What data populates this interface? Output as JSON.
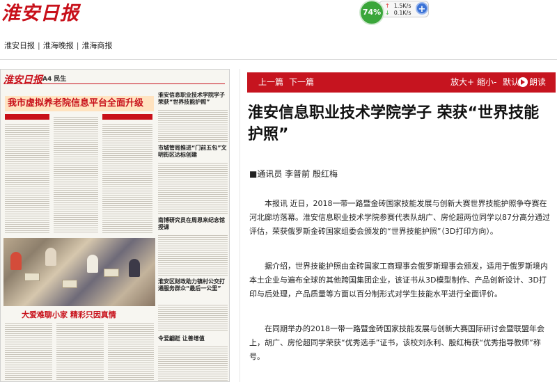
{
  "site": {
    "logo_text": "淮安日报"
  },
  "net_widget": {
    "cpu_percent": "74%",
    "upload": "1.5K/s",
    "download": "0.1K/s",
    "plus_icon": "plus-icon"
  },
  "nav": {
    "links": [
      "淮安日报",
      "淮海晚报",
      "淮海商报"
    ],
    "separator": "|"
  },
  "paper": {
    "masthead": "淮安日报",
    "edition": "A4 民生",
    "lead_headline": "我市虚拟养老院信息平台全面升级",
    "side_headlines": [
      "淮安信息职业技术学院学子荣获“世界技能护照”",
      "市城管局推进“门前五包”文明街区达标创建",
      "南博研究员在周恩来纪念馆授课",
      "淮安区财政助力镇村公交打通服务群众“最后一公里”",
      "令爱翩跹 让善增值"
    ],
    "photo_caption": "大爱难聊小家 精彩只因真情"
  },
  "toolbar": {
    "prev": "上一篇",
    "next": "下一篇",
    "zoom_in": "放大+",
    "zoom_out": "缩小-",
    "default": "默认",
    "read_aloud": "朗读",
    "accent_color": "#c6141f"
  },
  "article": {
    "title": "淮安信息职业技术学院学子 荣获“世界技能护照”",
    "byline": "■通讯员 李普前 殷红梅",
    "paragraphs": [
      "本报讯 近日，2018一带一路暨金砖国家技能发展与创新大赛世界技能护照争夺赛在河北廊坊落幕。淮安信息职业技术学院参赛代表队胡广、房伦超两位同学以87分高分通过评估，荣获俄罗斯金砖国家组委会颁发的“世界技能护照”（3D打印方向）。",
      "据介绍，世界技能护照由金砖国家工商理事会俄罗斯理事会颁发，适用于俄罗斯境内本土企业与遍布全球的其他跨国集团企业，该证书从3D模型制作、产品创新设计、3D打印与后处理，产品质量等方面以百分制形式对学生技能水平进行全面评价。",
      "在同期举办的2018一带一路暨金砖国家技能发展与创新大赛国际研讨会暨联盟年会上，胡广、房伦超同学荣获“优秀选手”证书，该校刘永利、殷红梅获“优秀指导教师”称号。"
    ]
  }
}
